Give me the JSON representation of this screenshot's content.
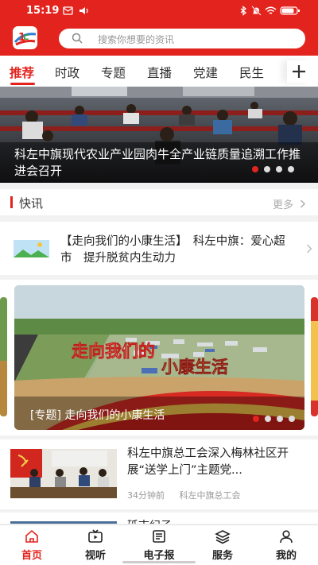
{
  "status_bar": {
    "time": "15:19",
    "battery": "81"
  },
  "search": {
    "placeholder": "搜索你想要的资讯"
  },
  "tabs": [
    {
      "label": "推荐",
      "active": true
    },
    {
      "label": "时政"
    },
    {
      "label": "专题"
    },
    {
      "label": "直播"
    },
    {
      "label": "党建"
    },
    {
      "label": "民生"
    }
  ],
  "hero": {
    "title": "科左中旗现代农业产业园肉牛全产业链质量追溯工作推进会召开"
  },
  "kuaixun": {
    "title": "快讯",
    "more": "更多",
    "item": "【走向我们的小康生活】　科左中旗：爱心超市　提升脱贫内生动力"
  },
  "special": {
    "caption": "[专题] 走向我们的小康生活",
    "image_text_1": "走向我们的",
    "image_text_2": "小康生活"
  },
  "news": [
    {
      "title": "科左中旗总工会深入梅林社区开展“送学上门”主题党...",
      "time": "34分钟前",
      "source": "科左中旗总工会"
    },
    {
      "title": "砥志纪子"
    }
  ],
  "bottom_nav": [
    {
      "label": "首页",
      "icon": "home-icon",
      "active": true
    },
    {
      "label": "视听",
      "icon": "tv-icon"
    },
    {
      "label": "电子报",
      "icon": "newspaper-icon"
    },
    {
      "label": "服务",
      "icon": "layers-icon"
    },
    {
      "label": "我的",
      "icon": "user-icon"
    }
  ],
  "colors": {
    "accent": "#e3241e"
  }
}
